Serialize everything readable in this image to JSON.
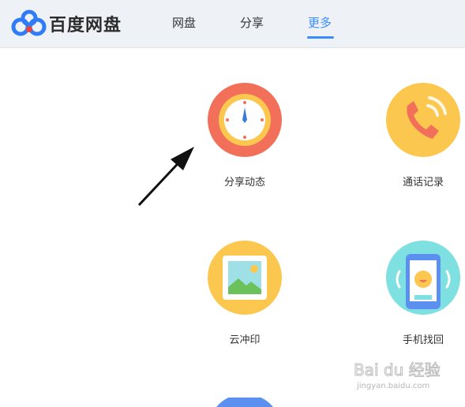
{
  "header": {
    "brand": "百度网盘",
    "tabs": [
      {
        "label": "网盘"
      },
      {
        "label": "分享"
      },
      {
        "label": "更多"
      }
    ],
    "active_tab": "更多",
    "accent_color": "#3b8cff"
  },
  "tiles": [
    {
      "label": "分享动态",
      "icon": "clock-icon"
    },
    {
      "label": "通话记录",
      "icon": "phone-icon"
    },
    {
      "label": "云冲印",
      "icon": "photo-icon"
    },
    {
      "label": "手机找回",
      "icon": "mobile-find-icon"
    }
  ],
  "watermark": {
    "text": "Bai du 经验",
    "url": "jingyan.baidu.com"
  }
}
